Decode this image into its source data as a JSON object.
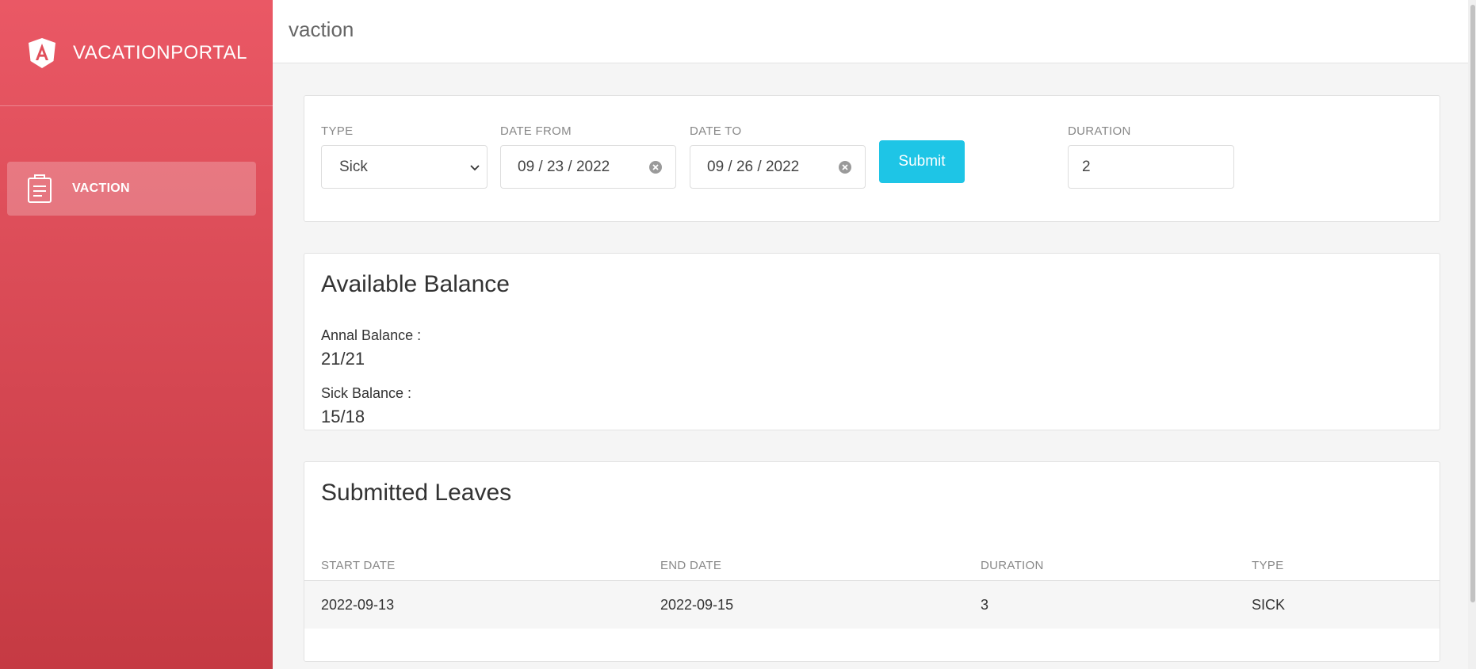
{
  "sidebar": {
    "brand": "VACATIONPORTAL",
    "items": [
      {
        "label": "VACTION",
        "icon": "clipboard-icon",
        "active": true
      }
    ]
  },
  "header": {
    "title": "vaction"
  },
  "form": {
    "type": {
      "label": "TYPE",
      "value": "Sick"
    },
    "date_from": {
      "label": "DATE FROM",
      "value": "09 / 23 / 2022"
    },
    "date_to": {
      "label": "DATE TO",
      "value": "09 / 26 / 2022"
    },
    "submit_label": "Submit",
    "duration": {
      "label": "DURATION",
      "value": "2"
    }
  },
  "balance": {
    "heading": "Available Balance",
    "annual_label": "Annal Balance :",
    "annual_value": "21/21",
    "sick_label": "Sick Balance :",
    "sick_value": "15/18"
  },
  "leaves": {
    "heading": "Submitted Leaves",
    "columns": [
      "START DATE",
      "END DATE",
      "DURATION",
      "TYPE"
    ],
    "rows": [
      [
        "2022-09-13",
        "2022-09-15",
        "3",
        "SICK"
      ]
    ]
  },
  "colors": {
    "sidebar_top": "#ea5865",
    "sidebar_bottom": "#c53a43",
    "submit": "#1ec5e6"
  }
}
